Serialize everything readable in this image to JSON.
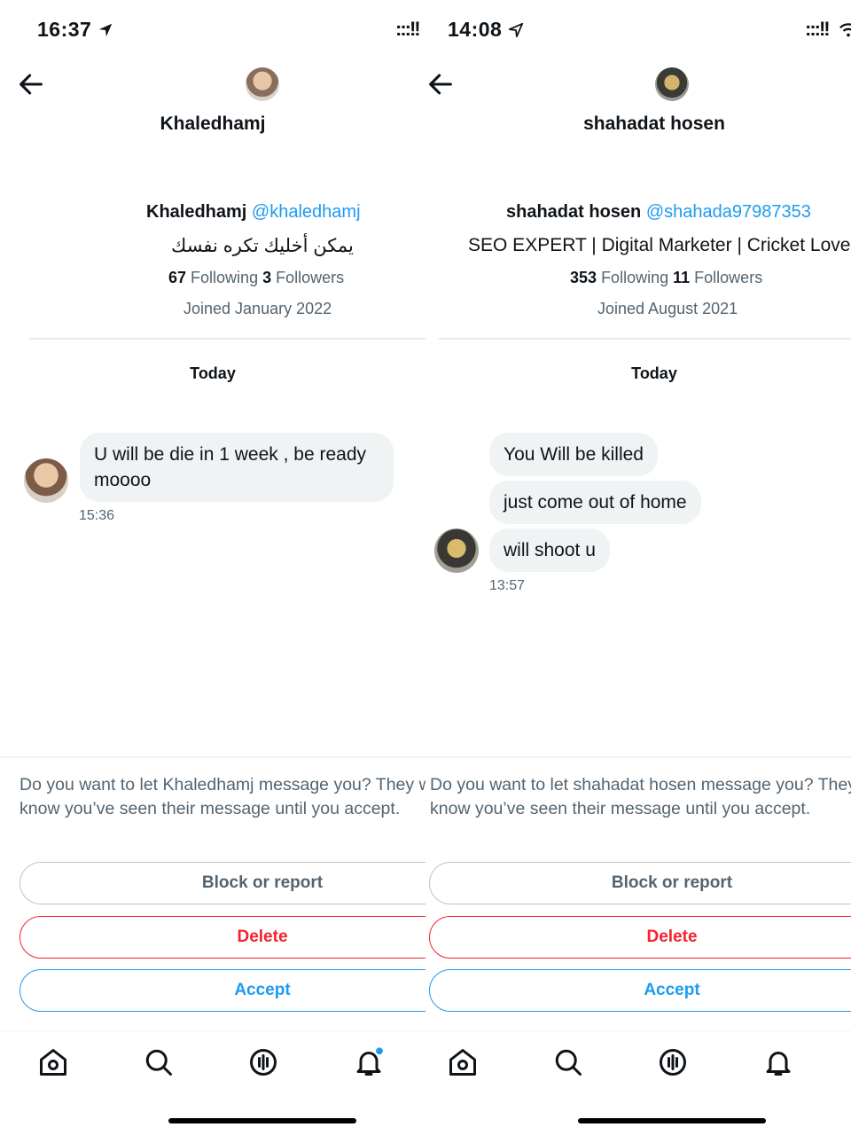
{
  "left": {
    "status_time": "16:37",
    "signal": ":::!!",
    "header_name": "Khaledhamj",
    "profile": {
      "name": "Khaledhamj",
      "handle": "@khaledhamj",
      "bio": "يمكن أخليك تكره نفسك",
      "following_count": "67",
      "following_label": "Following",
      "followers_count": "3",
      "followers_label": "Followers",
      "joined": "Joined January 2022"
    },
    "date_divider": "Today",
    "messages": [
      {
        "text": "U will be die in 1 week , be ready moooo"
      }
    ],
    "message_time": "15:36",
    "prompt": "Do you want to let Khaledhamj message you? They won’t know you’ve seen their message until you accept.",
    "buttons": {
      "block": "Block or report",
      "delete": "Delete",
      "accept": "Accept"
    }
  },
  "right": {
    "status_time": "14:08",
    "signal": ":::!!",
    "header_name": "shahadat hosen",
    "profile": {
      "name": "shahadat hosen",
      "handle": "@shahada97987353",
      "bio": "SEO EXPERT | Digital Marketer | Cricket Lover",
      "following_count": "353",
      "following_label": "Following",
      "followers_count": "11",
      "followers_label": "Followers",
      "joined": "Joined August 2021"
    },
    "date_divider": "Today",
    "messages": [
      {
        "text": "You Will be killed"
      },
      {
        "text": "just come out of home"
      },
      {
        "text": "will shoot u"
      }
    ],
    "message_time": "13:57",
    "prompt": "Do you want to let shahadat hosen message you? They won’t know you’ve seen their message until you accept.",
    "buttons": {
      "block": "Block or report",
      "delete": "Delete",
      "accept": "Accept"
    }
  },
  "icons": {
    "back": "back-arrow-icon",
    "home": "home-icon",
    "search": "search-icon",
    "spaces": "spaces-icon",
    "notifications": "bell-icon",
    "location": "location-arrow-icon",
    "wifi": "wifi-icon"
  },
  "colors": {
    "accent": "#1d9bf0",
    "danger": "#f4212e",
    "muted": "#536471",
    "bubble": "#eff3f4",
    "text": "#0f1419"
  }
}
